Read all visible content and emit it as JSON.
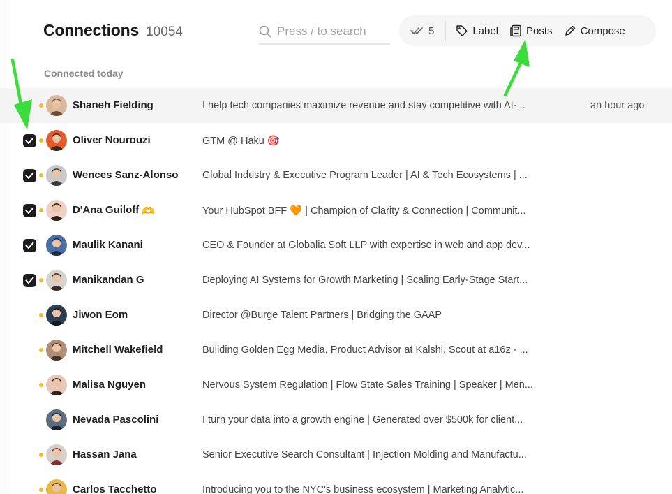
{
  "header": {
    "title": "Connections",
    "count": "10054"
  },
  "search": {
    "placeholder": "Press / to search"
  },
  "toolbar": {
    "selected_count": "5",
    "label_button": "Label",
    "posts_button": "Posts",
    "compose_button": "Compose"
  },
  "section": {
    "label": "Connected today"
  },
  "colors": {
    "accent_dot": "#f5b931",
    "annotation_arrow": "#3ddc3d",
    "checkbox": "#1d1d1f"
  },
  "rows": [
    {
      "name": "Shaneh Fielding",
      "emoji": "",
      "headline": "I help tech companies maximize revenue and stay competitive with AI-...",
      "time": "an hour ago",
      "checked": false,
      "dot": true,
      "highlighted": true
    },
    {
      "name": "Oliver Nourouzi",
      "emoji": "",
      "headline": "GTM @ Haku 🎯",
      "time": "",
      "checked": true,
      "dot": true,
      "highlighted": false
    },
    {
      "name": "Wences Sanz-Alonso",
      "emoji": "",
      "headline": "Global Industry & Executive Program Leader | AI & Tech Ecosystems | ...",
      "time": "",
      "checked": true,
      "dot": true,
      "highlighted": false
    },
    {
      "name": "D'Ana Guiloff",
      "emoji": "🫶",
      "headline": "Your HubSpot BFF 🧡 | Champion of Clarity & Connection | Communit...",
      "time": "",
      "checked": true,
      "dot": true,
      "highlighted": false
    },
    {
      "name": "Maulik Kanani",
      "emoji": "",
      "headline": "CEO & Founder at Globalia Soft LLP with expertise in web and app dev...",
      "time": "",
      "checked": true,
      "dot": false,
      "highlighted": false
    },
    {
      "name": "Manikandan G",
      "emoji": "",
      "headline": "Deploying AI Systems for Growth Marketing | Scaling Early-Stage Start...",
      "time": "",
      "checked": true,
      "dot": true,
      "highlighted": false
    },
    {
      "name": "Jiwon Eom",
      "emoji": "",
      "headline": "Director @Burge Talent Partners | Bridging the GAAP",
      "time": "",
      "checked": false,
      "dot": true,
      "highlighted": false
    },
    {
      "name": "Mitchell Wakefield",
      "emoji": "",
      "headline": "Building Golden Egg Media, Product Advisor at Kalshi, Scout at a16z - ...",
      "time": "",
      "checked": false,
      "dot": true,
      "highlighted": false
    },
    {
      "name": "Malisa Nguyen",
      "emoji": "",
      "headline": "Nervous System Regulation | Flow State Sales Training | Speaker | Men...",
      "time": "",
      "checked": false,
      "dot": true,
      "highlighted": false
    },
    {
      "name": "Nevada Pascolini",
      "emoji": "",
      "headline": "I turn your data into a growth engine | Generated over $500k for client...",
      "time": "",
      "checked": false,
      "dot": false,
      "highlighted": false
    },
    {
      "name": "Hassan Jana",
      "emoji": "",
      "headline": "Senior Executive Search Consultant | Injection Molding and Manufactu...",
      "time": "",
      "checked": false,
      "dot": true,
      "highlighted": false
    },
    {
      "name": "Carlos Tacchetto",
      "emoji": "",
      "headline": "Introducing you to the NYC's business ecosystem | Marketing Analytic...",
      "time": "",
      "checked": false,
      "dot": true,
      "highlighted": false
    }
  ]
}
